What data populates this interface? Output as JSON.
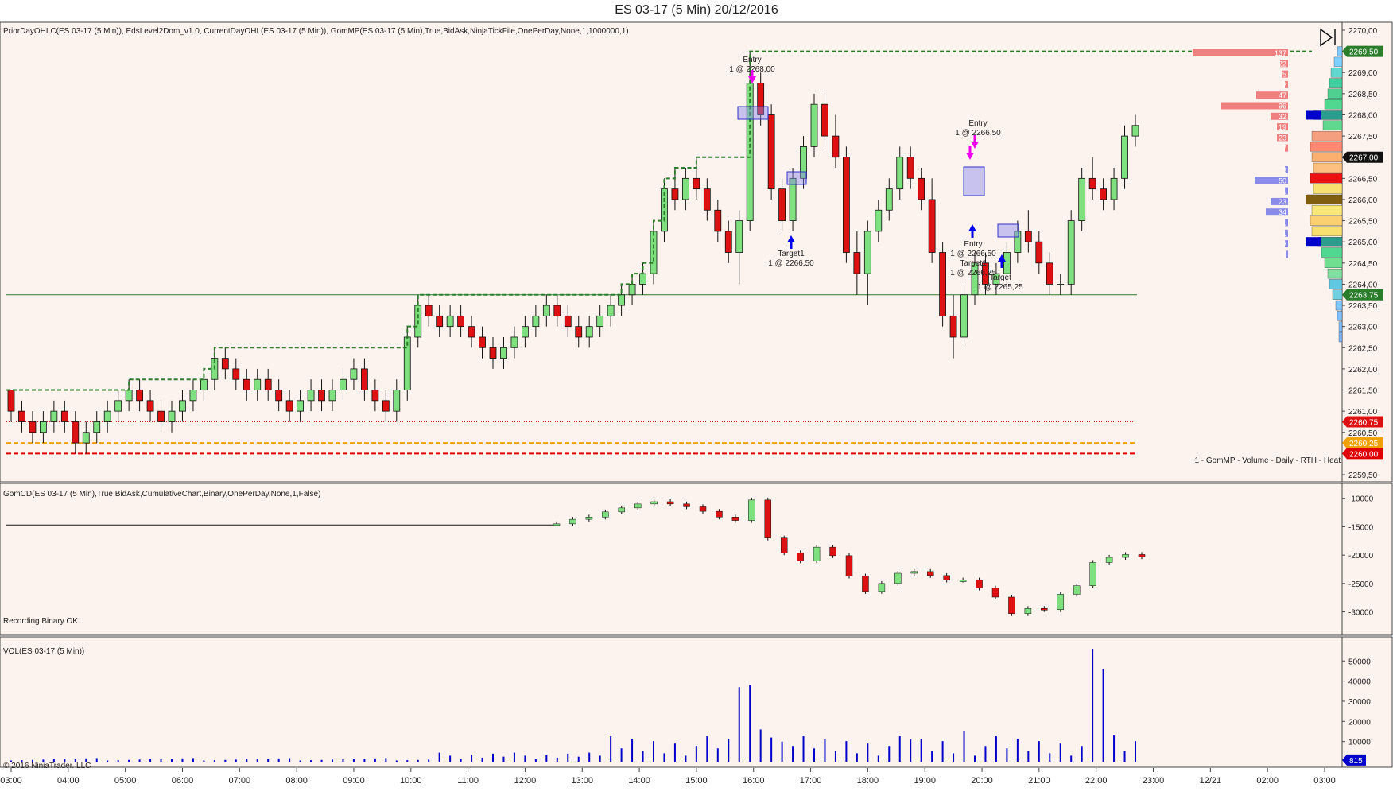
{
  "window": {
    "title": "ES 03-17 (5 Min)  20/12/2016"
  },
  "colors": {
    "bg": "#fdf3ee",
    "up": "#7ee07e",
    "down": "#dd1111",
    "wick": "#111111",
    "frame": "#666666",
    "vol": "#0000cc",
    "grid": "#1a1a1a",
    "green": "#2a7d2a",
    "red": "#e00000",
    "orange": "#f0a000"
  },
  "panel1": {
    "indicator_text": "PriorDayOHLC(ES 03-17 (5 Min)), EdsLevel2Dom_v1.0, CurrentDayOHL(ES 03-17 (5 Min)), GomMP(ES 03-17 (5 Min),True,BidAsk,NinjaTickFile,OnePerDay,None,1,1000000,1)",
    "profile_label": "1 - GomMP - Volume - Daily - RTH - Heat",
    "price_ticks": [
      "2270,00",
      "2269,50",
      "2269,00",
      "2268,50",
      "2268,00",
      "2267,50",
      "2267,00",
      "2266,50",
      "2266,00",
      "2265,50",
      "2265,00",
      "2264,50",
      "2264,00",
      "2263,50",
      "2263,00",
      "2262,50",
      "2262,00",
      "2261,50",
      "2261,00",
      "2260,50",
      "2260,00",
      "2259,50"
    ],
    "price_flags": [
      {
        "label": "2269,50",
        "color": "#2a7d2a"
      },
      {
        "label": "2267,00",
        "color": "#111111"
      },
      {
        "label": "2263,75",
        "color": "#2a7d2a"
      },
      {
        "label": "2260,75",
        "color": "#dd1111"
      },
      {
        "label": "2260,25",
        "color": "#f0a000"
      },
      {
        "label": "2260,00",
        "color": "#e00000"
      }
    ],
    "dom_ask_sizes": [
      "137",
      "22",
      "25",
      "2",
      "47",
      "96",
      "32",
      "19",
      "23",
      "7"
    ],
    "dom_bid_sizes": [
      "3",
      "50",
      "1",
      "23",
      "34",
      "1",
      "1",
      "3",
      "0"
    ],
    "annotations": [
      {
        "text": "Entry"
      },
      {
        "text": "1 @ 2268,00"
      },
      {
        "text": "Target1"
      },
      {
        "text": "1 @ 2266,50"
      },
      {
        "text": "Entry"
      },
      {
        "text": "1 @ 2266,50"
      },
      {
        "text": "Entry"
      },
      {
        "text": "1 @ 2266,50"
      },
      {
        "text": "Target1"
      },
      {
        "text": "1 @ 2266,25"
      },
      {
        "text": "Target"
      },
      {
        "text": "1 @ 2265,25"
      }
    ]
  },
  "panel2": {
    "indicator_text": "GomCD(ES 03-17 (5 Min),True,BidAsk,CumulativeChart,Binary,OnePerDay,None,1,False)",
    "status_text": "Recording Binary OK",
    "ticks": [
      "-10000",
      "-15000",
      "-20000",
      "-25000",
      "-30000"
    ]
  },
  "panel3": {
    "indicator_text": "VOL(ES 03-17 (5 Min))",
    "copyright": "© 2016 NinjaTrader, LLC",
    "ticks": [
      "50000",
      "40000",
      "30000",
      "20000",
      "10000"
    ],
    "last_volume": "815"
  },
  "time_axis": [
    "03:00",
    "04:00",
    "05:00",
    "06:00",
    "07:00",
    "08:00",
    "09:00",
    "10:00",
    "11:00",
    "12:00",
    "13:00",
    "14:00",
    "15:00",
    "16:00",
    "17:00",
    "18:00",
    "19:00",
    "20:00",
    "21:00",
    "22:00",
    "23:00",
    "12/21",
    "02:00",
    "03:00"
  ],
  "chart_data": {
    "type": "candlestick",
    "title": "ES 03-17 (5 Min)  20/12/2016",
    "y_range": [
      2259.5,
      2270.0
    ],
    "levels": {
      "prior_day_high_current": 2269.5,
      "green_line": 2263.75,
      "prior_close": 2260.75,
      "orange_level": 2260.25,
      "prior_low": 2260.0
    },
    "candles": [
      [
        2261.5,
        2261.5,
        2260.75,
        2261.0
      ],
      [
        2261.0,
        2261.25,
        2260.5,
        2260.75
      ],
      [
        2260.75,
        2261.0,
        2260.25,
        2260.5
      ],
      [
        2260.5,
        2261.0,
        2260.25,
        2260.75
      ],
      [
        2260.75,
        2261.25,
        2260.5,
        2261.0
      ],
      [
        2261.0,
        2261.25,
        2260.5,
        2260.75
      ],
      [
        2260.75,
        2261.0,
        2260.0,
        2260.25
      ],
      [
        2260.25,
        2260.75,
        2260.0,
        2260.5
      ],
      [
        2260.5,
        2261.0,
        2260.25,
        2260.75
      ],
      [
        2260.75,
        2261.25,
        2260.5,
        2261.0
      ],
      [
        2261.0,
        2261.5,
        2260.75,
        2261.25
      ],
      [
        2261.25,
        2261.75,
        2261.0,
        2261.5
      ],
      [
        2261.5,
        2261.75,
        2261.0,
        2261.25
      ],
      [
        2261.25,
        2261.5,
        2260.75,
        2261.0
      ],
      [
        2261.0,
        2261.25,
        2260.5,
        2260.75
      ],
      [
        2260.75,
        2261.25,
        2260.5,
        2261.0
      ],
      [
        2261.0,
        2261.5,
        2260.75,
        2261.25
      ],
      [
        2261.25,
        2261.75,
        2261.0,
        2261.5
      ],
      [
        2261.5,
        2262.0,
        2261.25,
        2261.75
      ],
      [
        2261.75,
        2262.5,
        2261.5,
        2262.25
      ],
      [
        2262.25,
        2262.5,
        2261.75,
        2262.0
      ],
      [
        2262.0,
        2262.25,
        2261.5,
        2261.75
      ],
      [
        2261.75,
        2262.0,
        2261.25,
        2261.5
      ],
      [
        2261.5,
        2262.0,
        2261.25,
        2261.75
      ],
      [
        2261.75,
        2262.0,
        2261.25,
        2261.5
      ],
      [
        2261.5,
        2261.75,
        2261.0,
        2261.25
      ],
      [
        2261.25,
        2261.5,
        2260.75,
        2261.0
      ],
      [
        2261.0,
        2261.5,
        2260.75,
        2261.25
      ],
      [
        2261.25,
        2261.75,
        2261.0,
        2261.5
      ],
      [
        2261.5,
        2261.75,
        2261.0,
        2261.25
      ],
      [
        2261.25,
        2261.75,
        2261.0,
        2261.5
      ],
      [
        2261.5,
        2262.0,
        2261.25,
        2261.75
      ],
      [
        2261.75,
        2262.25,
        2261.5,
        2262.0
      ],
      [
        2262.0,
        2262.25,
        2261.25,
        2261.5
      ],
      [
        2261.5,
        2261.75,
        2261.0,
        2261.25
      ],
      [
        2261.25,
        2261.5,
        2260.75,
        2261.0
      ],
      [
        2261.0,
        2261.75,
        2260.75,
        2261.5
      ],
      [
        2261.5,
        2263.0,
        2261.25,
        2262.75
      ],
      [
        2262.75,
        2263.75,
        2262.5,
        2263.5
      ],
      [
        2263.5,
        2263.75,
        2263.0,
        2263.25
      ],
      [
        2263.25,
        2263.5,
        2262.75,
        2263.0
      ],
      [
        2263.0,
        2263.5,
        2262.75,
        2263.25
      ],
      [
        2263.25,
        2263.5,
        2262.75,
        2263.0
      ],
      [
        2263.0,
        2263.25,
        2262.5,
        2262.75
      ],
      [
        2262.75,
        2263.0,
        2262.25,
        2262.5
      ],
      [
        2262.5,
        2262.75,
        2262.0,
        2262.25
      ],
      [
        2262.25,
        2262.75,
        2262.0,
        2262.5
      ],
      [
        2262.5,
        2263.0,
        2262.25,
        2262.75
      ],
      [
        2262.75,
        2263.25,
        2262.5,
        2263.0
      ],
      [
        2263.0,
        2263.5,
        2262.75,
        2263.25
      ],
      [
        2263.25,
        2263.75,
        2263.0,
        2263.5
      ],
      [
        2263.5,
        2263.75,
        2263.0,
        2263.25
      ],
      [
        2263.25,
        2263.5,
        2262.75,
        2263.0
      ],
      [
        2263.0,
        2263.25,
        2262.5,
        2262.75
      ],
      [
        2262.75,
        2263.25,
        2262.5,
        2263.0
      ],
      [
        2263.0,
        2263.5,
        2262.75,
        2263.25
      ],
      [
        2263.25,
        2263.75,
        2263.0,
        2263.5
      ],
      [
        2263.5,
        2264.0,
        2263.25,
        2263.75
      ],
      [
        2263.75,
        2264.25,
        2263.5,
        2264.0
      ],
      [
        2264.0,
        2264.5,
        2263.75,
        2264.25
      ],
      [
        2264.25,
        2265.5,
        2264.0,
        2265.25
      ],
      [
        2265.25,
        2266.5,
        2265.0,
        2266.25
      ],
      [
        2266.25,
        2266.75,
        2265.75,
        2266.0
      ],
      [
        2266.0,
        2266.75,
        2265.75,
        2266.5
      ],
      [
        2266.5,
        2267.0,
        2266.0,
        2266.25
      ],
      [
        2266.25,
        2266.5,
        2265.5,
        2265.75
      ],
      [
        2265.75,
        2266.0,
        2265.0,
        2265.25
      ],
      [
        2265.25,
        2265.5,
        2264.5,
        2264.75
      ],
      [
        2264.75,
        2265.75,
        2264.0,
        2265.5
      ],
      [
        2265.5,
        2269.5,
        2265.25,
        2268.75
      ],
      [
        2268.75,
        2269.0,
        2267.75,
        2268.0
      ],
      [
        2268.0,
        2268.25,
        2266.0,
        2266.25
      ],
      [
        2266.25,
        2266.5,
        2265.25,
        2265.5
      ],
      [
        2265.5,
        2266.75,
        2265.25,
        2266.5
      ],
      [
        2266.5,
        2267.5,
        2266.25,
        2267.25
      ],
      [
        2267.25,
        2268.5,
        2267.0,
        2268.25
      ],
      [
        2268.25,
        2268.5,
        2267.25,
        2267.5
      ],
      [
        2267.5,
        2268.0,
        2266.75,
        2267.0
      ],
      [
        2267.0,
        2267.25,
        2264.5,
        2264.75
      ],
      [
        2264.75,
        2265.25,
        2263.75,
        2264.25
      ],
      [
        2264.25,
        2265.5,
        2263.5,
        2265.25
      ],
      [
        2265.25,
        2266.0,
        2265.0,
        2265.75
      ],
      [
        2265.75,
        2266.5,
        2265.5,
        2266.25
      ],
      [
        2266.25,
        2267.25,
        2266.0,
        2267.0
      ],
      [
        2267.0,
        2267.25,
        2266.25,
        2266.5
      ],
      [
        2266.5,
        2266.75,
        2265.75,
        2266.0
      ],
      [
        2266.0,
        2266.5,
        2264.5,
        2264.75
      ],
      [
        2264.75,
        2265.0,
        2263.0,
        2263.25
      ],
      [
        2263.25,
        2263.75,
        2262.25,
        2262.75
      ],
      [
        2262.75,
        2264.0,
        2262.5,
        2263.75
      ],
      [
        2263.75,
        2264.75,
        2263.5,
        2264.5
      ],
      [
        2264.5,
        2264.75,
        2263.75,
        2264.0
      ],
      [
        2264.0,
        2264.5,
        2263.75,
        2264.25
      ],
      [
        2264.25,
        2265.0,
        2264.0,
        2264.75
      ],
      [
        2264.75,
        2265.5,
        2264.5,
        2265.25
      ],
      [
        2265.25,
        2265.75,
        2264.75,
        2265.0
      ],
      [
        2265.0,
        2265.25,
        2264.25,
        2264.5
      ],
      [
        2264.5,
        2264.75,
        2263.75,
        2264.0
      ],
      [
        2264.0,
        2264.25,
        2263.75,
        2264.0
      ],
      [
        2264.0,
        2265.75,
        2263.75,
        2265.5
      ],
      [
        2265.5,
        2266.75,
        2265.25,
        2266.5
      ],
      [
        2266.5,
        2267.0,
        2266.0,
        2266.25
      ],
      [
        2266.25,
        2266.5,
        2265.75,
        2266.0
      ],
      [
        2266.0,
        2266.75,
        2265.75,
        2266.5
      ],
      [
        2266.5,
        2267.75,
        2266.25,
        2267.5
      ],
      [
        2267.5,
        2268.0,
        2267.25,
        2267.75
      ]
    ]
  }
}
